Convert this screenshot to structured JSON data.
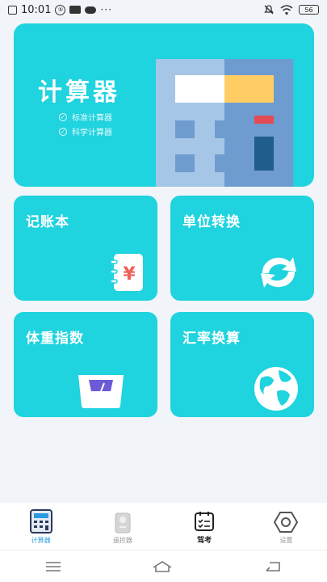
{
  "status_bar": {
    "time": "10:01",
    "badge": "⑤",
    "battery": "56",
    "dots": "···"
  },
  "hero": {
    "title": "计算器",
    "features": [
      "标准计算器",
      "科学计算器"
    ]
  },
  "tiles": [
    {
      "label": "记账本",
      "icon": "yuan-notebook-icon"
    },
    {
      "label": "单位转换",
      "icon": "refresh-arrows-icon"
    },
    {
      "label": "体重指数",
      "icon": "scale-icon"
    },
    {
      "label": "汇率换算",
      "icon": "globe-icon"
    }
  ],
  "bottom_nav": [
    {
      "label": "计算器",
      "icon": "calculator-icon",
      "active": true
    },
    {
      "label": "遥控器",
      "icon": "remote-icon",
      "active": false
    },
    {
      "label": "驾考",
      "icon": "calendar-checklist-icon",
      "active": false
    },
    {
      "label": "设置",
      "icon": "hexagon-settings-icon",
      "active": false
    }
  ],
  "colors": {
    "accent": "#1fd3df",
    "nav_active": "#2a9be3",
    "background": "#f1f4f8"
  }
}
